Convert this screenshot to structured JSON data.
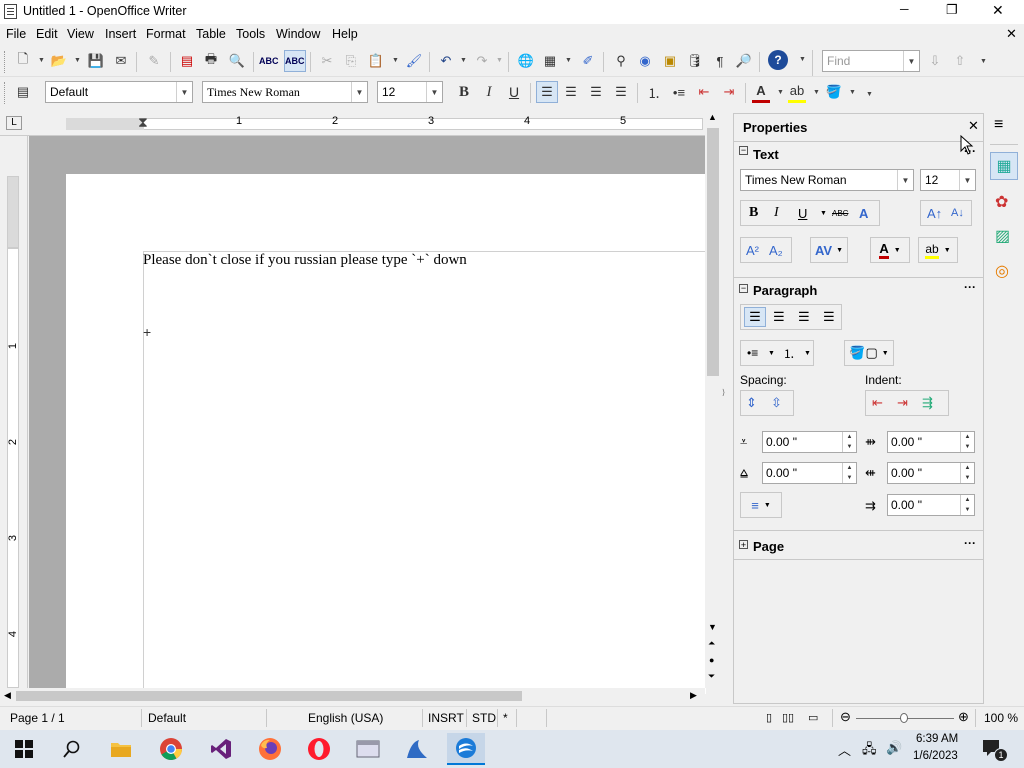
{
  "window": {
    "title": "Untitled 1 - OpenOffice Writer",
    "minimize": "─",
    "maximize": "❐",
    "close": "✕",
    "doc_close": "✕"
  },
  "menu": [
    "File",
    "Edit",
    "View",
    "Insert",
    "Format",
    "Table",
    "Tools",
    "Window",
    "Help"
  ],
  "toolbar": {
    "find_placeholder": "Find",
    "style_value": "Default",
    "font_value": "Times New Roman",
    "size_value": "12",
    "bold": "B",
    "italic": "I",
    "underline": "U"
  },
  "ruler": {
    "numbers": [
      "1",
      "2",
      "3",
      "4",
      "5"
    ],
    "vnumbers": [
      "1",
      "2",
      "3",
      "4"
    ]
  },
  "document": {
    "text_line": "Please don`t close if you russian please type `+` down",
    "cursor": "+"
  },
  "sidebar": {
    "title": "Properties",
    "text_section": "Text",
    "font_value": "Times New Roman",
    "size_value": "12",
    "paragraph_section": "Paragraph",
    "spacing_label": "Spacing:",
    "indent_label": "Indent:",
    "spin_values": [
      "0.00 \"",
      "0.00 \"",
      "0.00 \"",
      "0.00 \"",
      "0.00 \""
    ],
    "page_section": "Page",
    "more": "···"
  },
  "statusbar": {
    "page": "Page 1 / 1",
    "style": "Default",
    "language": "English (USA)",
    "mode": "INSRT",
    "selection": "STD",
    "modified": "*",
    "zoom": "100 %"
  },
  "taskbar": {
    "time": "6:39 AM",
    "date": "1/6/2023",
    "notification_count": "1"
  },
  "colors": {
    "accent": "#0078d7",
    "taskbar": "#dfe6ee",
    "doc_bg": "#ababab",
    "font_color": "#c00000",
    "highlight": "#ffff00"
  }
}
